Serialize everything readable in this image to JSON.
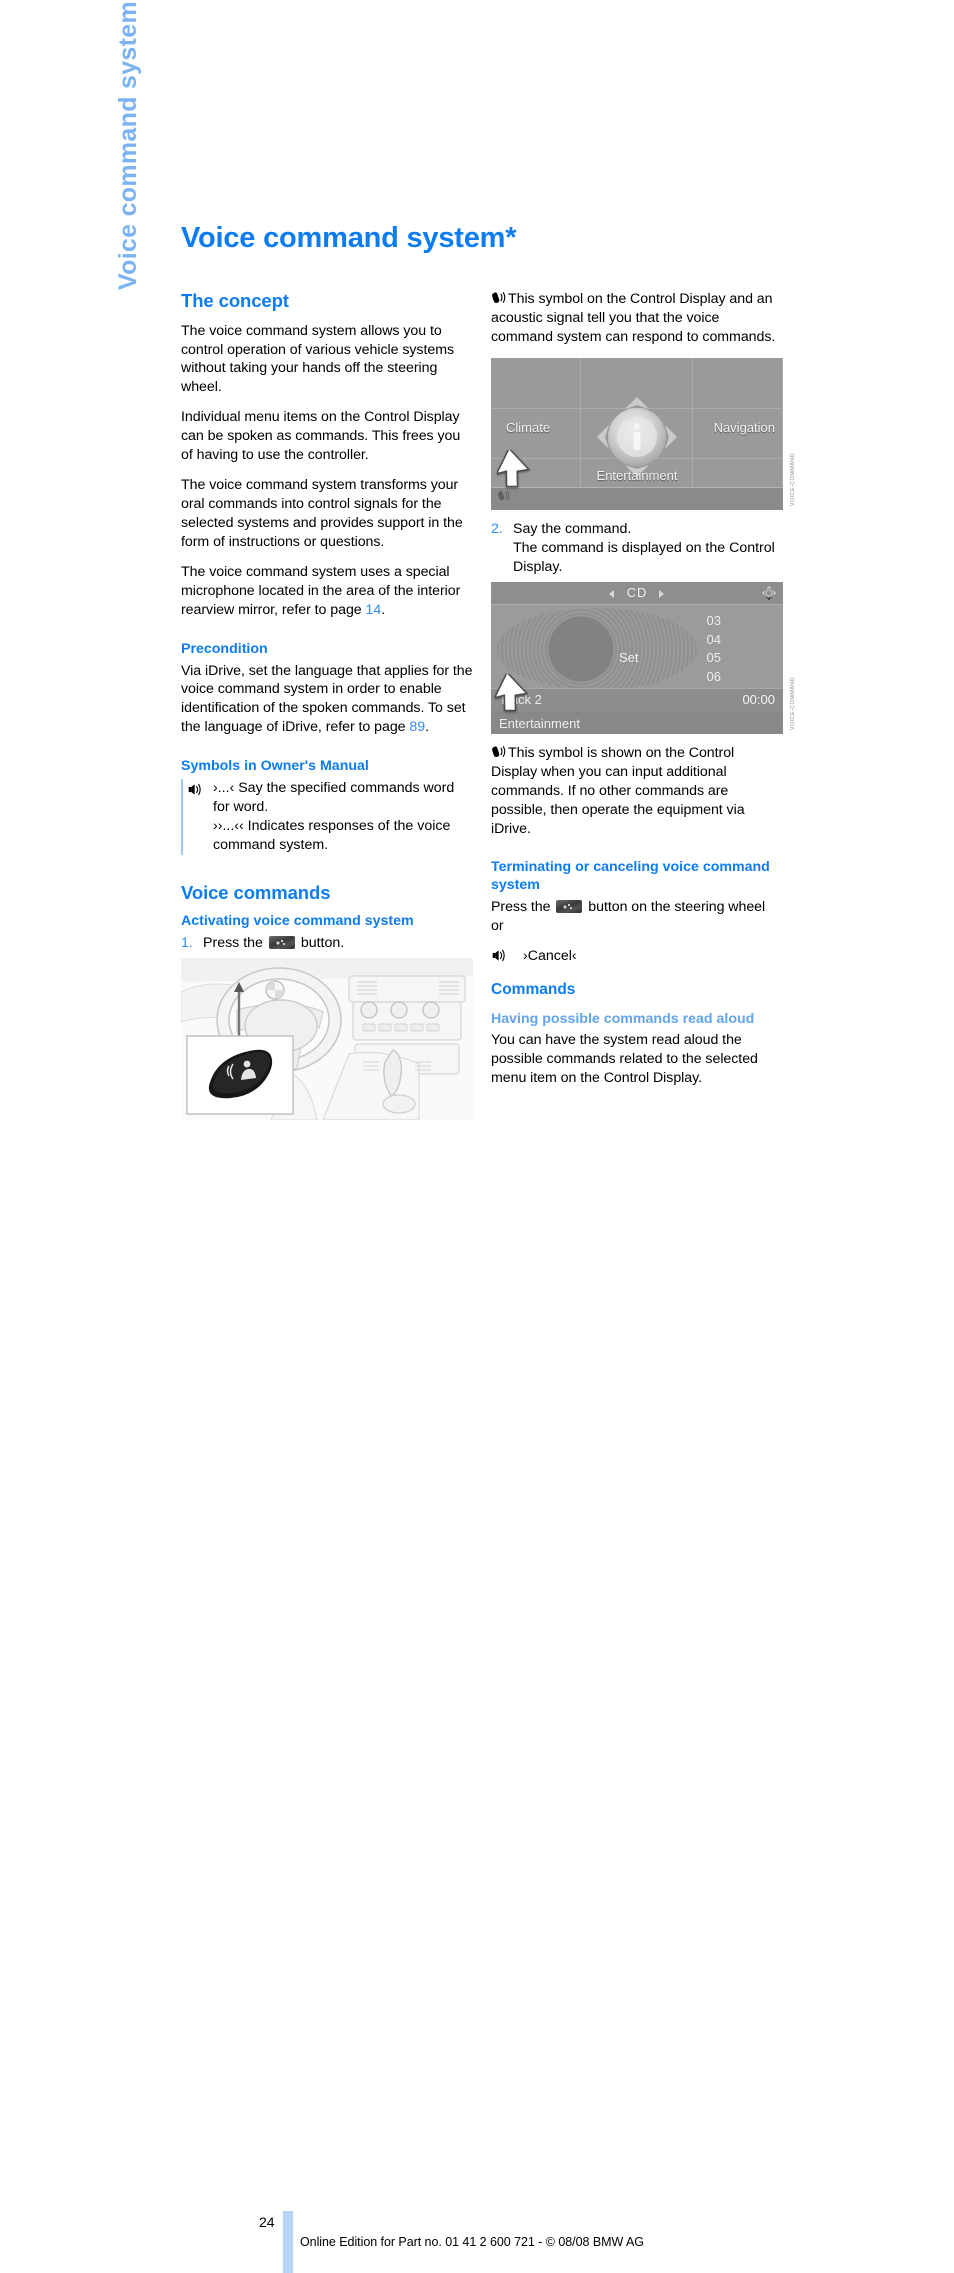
{
  "chapter_tab": "Voice command system",
  "page_title": "Voice command system*",
  "left_column": {
    "concept": {
      "heading": "The concept",
      "paragraphs": [
        "The voice command system allows you to control operation of various vehicle systems without taking your hands off the steering wheel.",
        "Individual menu items on the Control Display can be spoken as commands. This frees you of having to use the controller.",
        "The voice command system transforms your oral commands into control signals for the selected systems and provides support in the form of instructions or questions."
      ],
      "paragraph_with_ref": {
        "text_before": "The voice command system uses a special microphone located in the area of the interior rearview mirror, refer to page ",
        "ref": "14",
        "text_after": "."
      }
    },
    "precondition": {
      "heading": "Precondition",
      "text_before": "Via iDrive, set the language that applies for the voice command system in order to enable identification of the spoken commands. To set the language of iDrive, refer to page ",
      "ref": "89",
      "text_after": "."
    },
    "symbols": {
      "heading": "Symbols in Owner's Manual",
      "glyph": "speak-symbol-icon",
      "line1": "›...‹ Say the specified commands word for word.",
      "line2": "››...‹‹ Indicates responses of the voice command system."
    },
    "voice_commands": {
      "heading": "Voice commands",
      "activating": {
        "heading": "Activating voice command system",
        "step_number": "1.",
        "text_before": "Press the ",
        "button_icon": "voice-button-icon",
        "text_after": " button."
      },
      "figure": {
        "name": "steering-wheel-interior-figure",
        "alt": "BMW interior with steering wheel voice button callout"
      }
    }
  },
  "right_column": {
    "symbol_note_1": {
      "glyph": "mic-symbol-icon",
      "text": "This symbol on the Control Display and an acoustic signal tell you that the voice command system can respond to commands."
    },
    "figure_idrive": {
      "name": "idrive-main-menu-figure",
      "labels": {
        "climate": "Climate",
        "navigation": "Navigation",
        "entertainment": "Entertainment",
        "center_icon": "info-icon"
      },
      "watermark": "VOICE-COMMAND"
    },
    "step2": {
      "step_number": "2.",
      "line1": "Say the command.",
      "line2": "The command is displayed on the Control Display."
    },
    "figure_cd": {
      "name": "cd-playback-figure",
      "title": "CD",
      "set_label": "Set",
      "tracks": [
        "03",
        "04",
        "05",
        "06"
      ],
      "track_name": "Track 2",
      "time": "00:00",
      "bottom_label": "Entertainment",
      "watermark": "VOICE-COMMAND"
    },
    "symbol_note_2": {
      "glyph": "mic-symbol-icon",
      "text": "This symbol is shown on the Control Display when you can input additional commands. If no other commands are possible, then operate the equipment via iDrive."
    },
    "terminating": {
      "heading": "Terminating or canceling voice command system",
      "text_before": "Press the ",
      "button_icon": "voice-button-icon",
      "text_after": " button on the steering wheel",
      "or": "or",
      "cancel_glyph": "speak-symbol-icon",
      "cancel_command": "›Cancel‹"
    },
    "commands": {
      "heading": "Commands",
      "subheading": "Having possible commands read aloud",
      "text": "You can have the system read aloud the possible commands related to the selected menu item on the Control Display."
    }
  },
  "footer": {
    "page_number": "24",
    "text": "Online Edition for Part no. 01 41 2 600 721 - © 08/08 BMW AG"
  },
  "colors": {
    "heading_blue": "#0d7cf2",
    "light_blue": "#62a4ee",
    "tab_blue": "#7cb3f2",
    "rule_blue": "#9ec9f5",
    "footer_bar": "#b6d4f7"
  }
}
